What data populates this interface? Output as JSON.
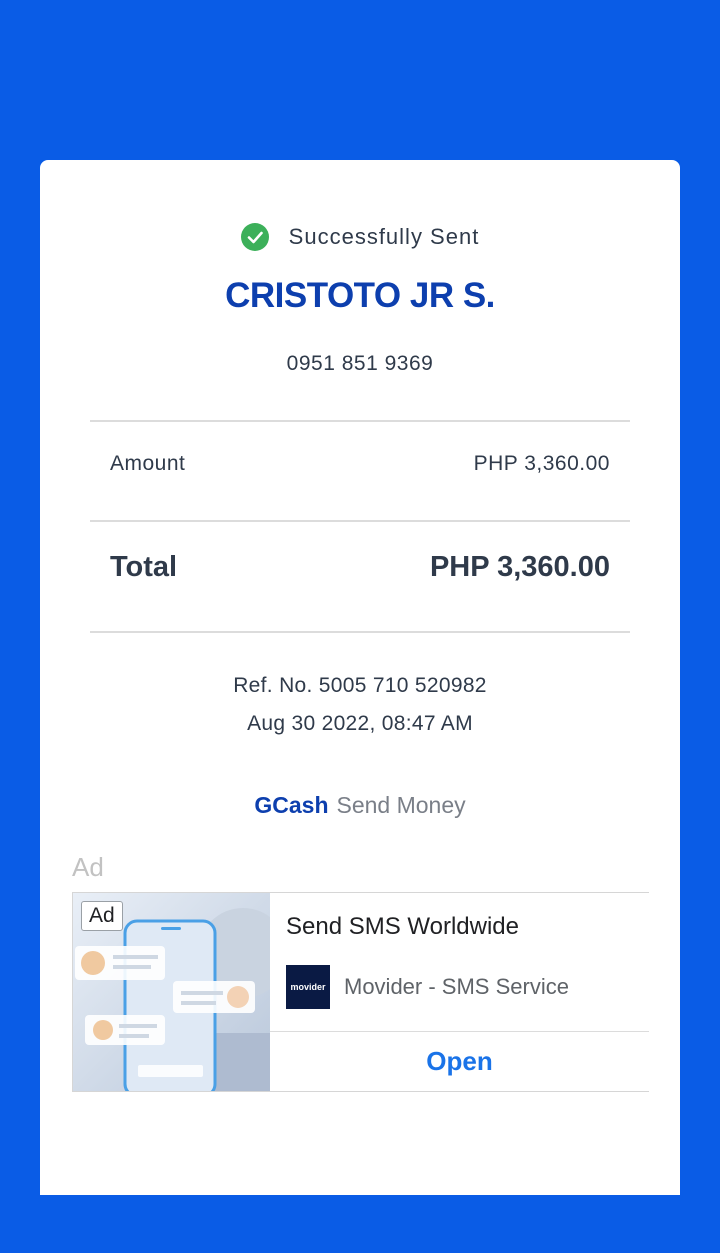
{
  "receipt": {
    "status": "Successfully Sent",
    "recipient_name": "CRISTOTO JR S.",
    "recipient_number": "0951 851 9369",
    "amount_label": "Amount",
    "amount_value": "PHP 3,360.00",
    "total_label": "Total",
    "total_value": "PHP 3,360.00",
    "reference": "Ref. No. 5005 710 520982",
    "datetime": "Aug 30 2022, 08:47 AM",
    "brand": "GCash",
    "service": "Send Money"
  },
  "ad": {
    "section_label": "Ad",
    "badge": "Ad",
    "headline": "Send SMS Worldwide",
    "logo_text": "movider",
    "advertiser": "Movider - SMS Service",
    "cta": "Open"
  },
  "colors": {
    "background": "#0a5ce6",
    "brand_blue": "#0d3fae",
    "success_green": "#3cb05a",
    "cta_blue": "#1a73e8"
  },
  "icons": {
    "status": "check-circle-icon"
  }
}
